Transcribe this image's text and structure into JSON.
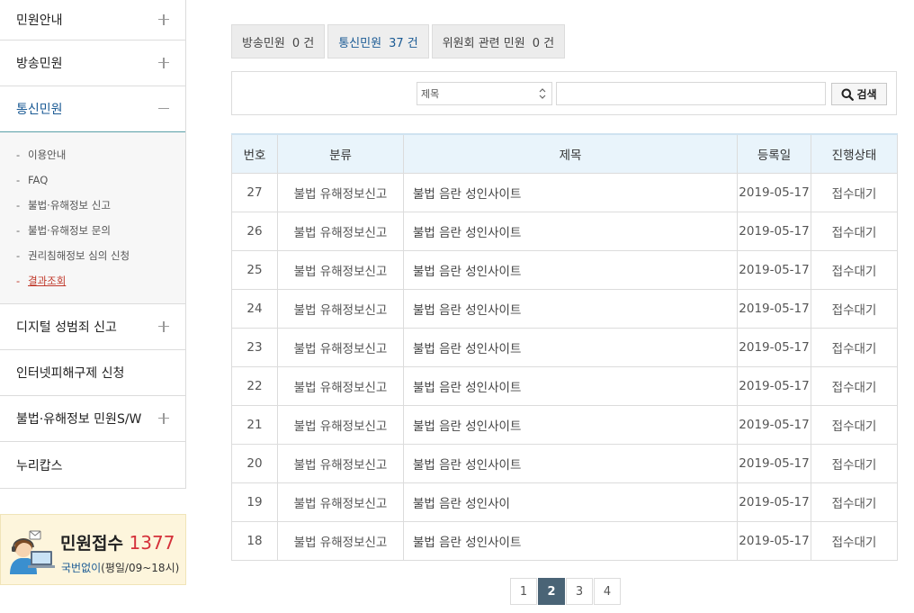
{
  "sidebar": {
    "items_top": [
      {
        "label": "민원안내",
        "toggle": "plus"
      },
      {
        "label": "방송민원",
        "toggle": "plus"
      },
      {
        "label": "통신민원",
        "toggle": "minus",
        "active": true
      }
    ],
    "submenu": [
      {
        "label": "이용안내"
      },
      {
        "label": "FAQ"
      },
      {
        "label": "불법·유해정보 신고"
      },
      {
        "label": "불법·유해정보 문의"
      },
      {
        "label": "권리침해정보 심의 신청"
      },
      {
        "label": "결과조회",
        "current": true
      }
    ],
    "items_bottom": [
      {
        "label": "디지털 성범죄 신고",
        "toggle": "plus"
      },
      {
        "label": "인터넷피해구제 신청",
        "toggle": ""
      },
      {
        "label": "불법·유해정보 민원S/W",
        "toggle": "plus"
      },
      {
        "label": "누리캅스",
        "toggle": ""
      }
    ],
    "dash": "-"
  },
  "callbox": {
    "title": "민원접수",
    "number": "1377",
    "highlight": "국번없이",
    "hours": "(평일/09~18시)"
  },
  "tabs": [
    {
      "label": "방송민원",
      "count": "0 건"
    },
    {
      "label": "통신민원",
      "count": "37 건",
      "active": true
    },
    {
      "label": "위원회 관련 민원",
      "count": "0 건"
    }
  ],
  "search": {
    "select_value": "제목",
    "input_value": "",
    "button_label": "검색"
  },
  "table": {
    "headers": [
      "번호",
      "분류",
      "제목",
      "등록일",
      "진행상태"
    ],
    "rows": [
      [
        "27",
        "불법 유해정보신고",
        "불법 음란 성인사이트",
        "2019-05-17",
        "접수대기"
      ],
      [
        "26",
        "불법 유해정보신고",
        "불법 음란 성인사이트",
        "2019-05-17",
        "접수대기"
      ],
      [
        "25",
        "불법 유해정보신고",
        "불법 음란 성인사이트",
        "2019-05-17",
        "접수대기"
      ],
      [
        "24",
        "불법 유해정보신고",
        "불법 음란 성인사이트",
        "2019-05-17",
        "접수대기"
      ],
      [
        "23",
        "불법 유해정보신고",
        "불법 음란 성인사이트",
        "2019-05-17",
        "접수대기"
      ],
      [
        "22",
        "불법 유해정보신고",
        "불법 음란 성인사이트",
        "2019-05-17",
        "접수대기"
      ],
      [
        "21",
        "불법 유해정보신고",
        "불법 음란 성인사이트",
        "2019-05-17",
        "접수대기"
      ],
      [
        "20",
        "불법 유해정보신고",
        "불법 음란 성인사이트",
        "2019-05-17",
        "접수대기"
      ],
      [
        "19",
        "불법 유해정보신고",
        "불법 음란 성인사이",
        "2019-05-17",
        "접수대기"
      ],
      [
        "18",
        "불법 유해정보신고",
        "불법 음란 성인사이트",
        "2019-05-17",
        "접수대기"
      ]
    ]
  },
  "pagination": {
    "pages": [
      "1",
      "2",
      "3",
      "4"
    ],
    "current": "2"
  },
  "colors": {
    "accent": "#1a5a94",
    "current_sub": "#c0392b",
    "callnum": "#d5313a",
    "pager_active": "#4a6476"
  }
}
